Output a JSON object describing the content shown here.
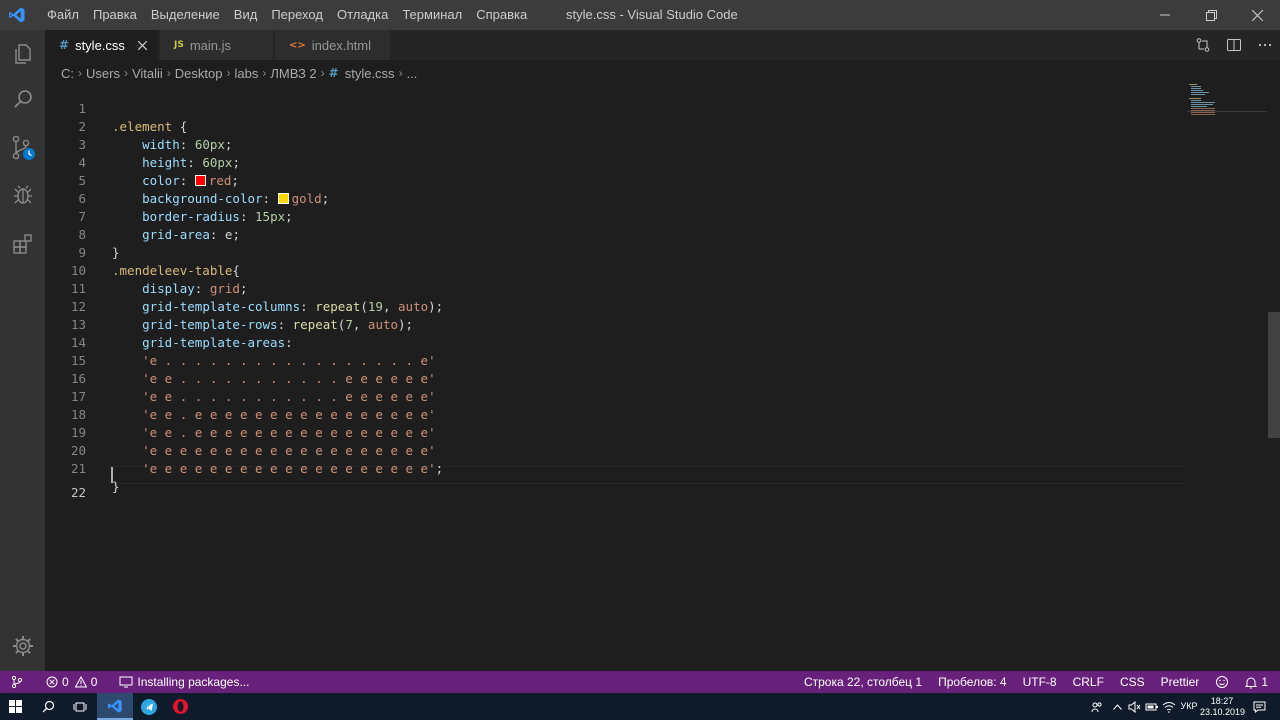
{
  "window": {
    "title": "style.css - Visual Studio Code",
    "menu": [
      "Файл",
      "Правка",
      "Выделение",
      "Вид",
      "Переход",
      "Отладка",
      "Терминал",
      "Справка"
    ]
  },
  "tabs": [
    {
      "label": "style.css",
      "icon": "#",
      "icon_color": "#519aba",
      "active": true
    },
    {
      "label": "main.js",
      "icon": "JS",
      "icon_color": "#cbcb41",
      "active": false
    },
    {
      "label": "index.html",
      "icon": "<>",
      "icon_color": "#e37933",
      "active": false
    }
  ],
  "breadcrumb": {
    "items": [
      "C:",
      "Users",
      "Vitalii",
      "Desktop",
      "labs",
      "ЛМВЗ 2",
      "style.css",
      "..."
    ],
    "file_icon": "#"
  },
  "editor": {
    "current_line": 22,
    "line_numbers": [
      "1",
      "2",
      "3",
      "4",
      "5",
      "6",
      "7",
      "8",
      "9",
      "10",
      "11",
      "12",
      "13",
      "14",
      "15",
      "16",
      "17",
      "18",
      "19",
      "20",
      "21",
      "22"
    ],
    "code": {
      "l1_sel": ".element",
      "l1_brace": " {",
      "l2_prop": "width",
      "l2_val": "60px",
      "l3_prop": "height",
      "l3_val": "60px",
      "l4_prop": "color",
      "l4_val": "red",
      "l4_swatch": "#ff0000",
      "l5_prop": "background-color",
      "l5_val": "gold",
      "l5_swatch": "#ffd700",
      "l6_prop": "border-radius",
      "l6_val": "15px",
      "l7_prop": "grid-area",
      "l7_val": "e",
      "l8": "}",
      "l9_sel": ".mendeleev-table",
      "l9_brace": "{",
      "l10_prop": "display",
      "l10_val": "grid",
      "l11_prop": "grid-template-columns",
      "l11_fn": "repeat",
      "l11_num": "19",
      "l11_val": "auto",
      "l12_prop": "grid-template-rows",
      "l12_fn": "repeat",
      "l12_num": "7",
      "l12_val": "auto",
      "l13_prop": "grid-template-areas",
      "l14": "'e . . . . . . . . . . . . . . . . . e'",
      "l15": "'e e . . . . . . . . . . . e e e e e e'",
      "l16": "'e e . . . . . . . . . . . e e e e e e'",
      "l17": "'e e . e e e e e e e e e e e e e e e e'",
      "l18": "'e e . e e e e e e e e e e e e e e e e'",
      "l19": "'e e e e e e e e e e e e e e e e e e e'",
      "l20": "'e e e e e e e e e e e e e e e e e e e'",
      "l20_end": ";",
      "l21": "}"
    }
  },
  "statusbar": {
    "errors": "0",
    "warnings": "0",
    "installing": "Installing packages...",
    "position": "Строка 22, столбец 1",
    "spaces": "Пробелов: 4",
    "encoding": "UTF-8",
    "eol": "CRLF",
    "language": "CSS",
    "formatter": "Prettier",
    "notifications": "1"
  },
  "taskbar": {
    "lang": "УКР",
    "time": "18:27",
    "date": "23.10.2019"
  },
  "colors": {
    "statusbar_bg": "#68217a",
    "editor_bg": "#1e1e1e",
    "accent": "#007acc"
  }
}
